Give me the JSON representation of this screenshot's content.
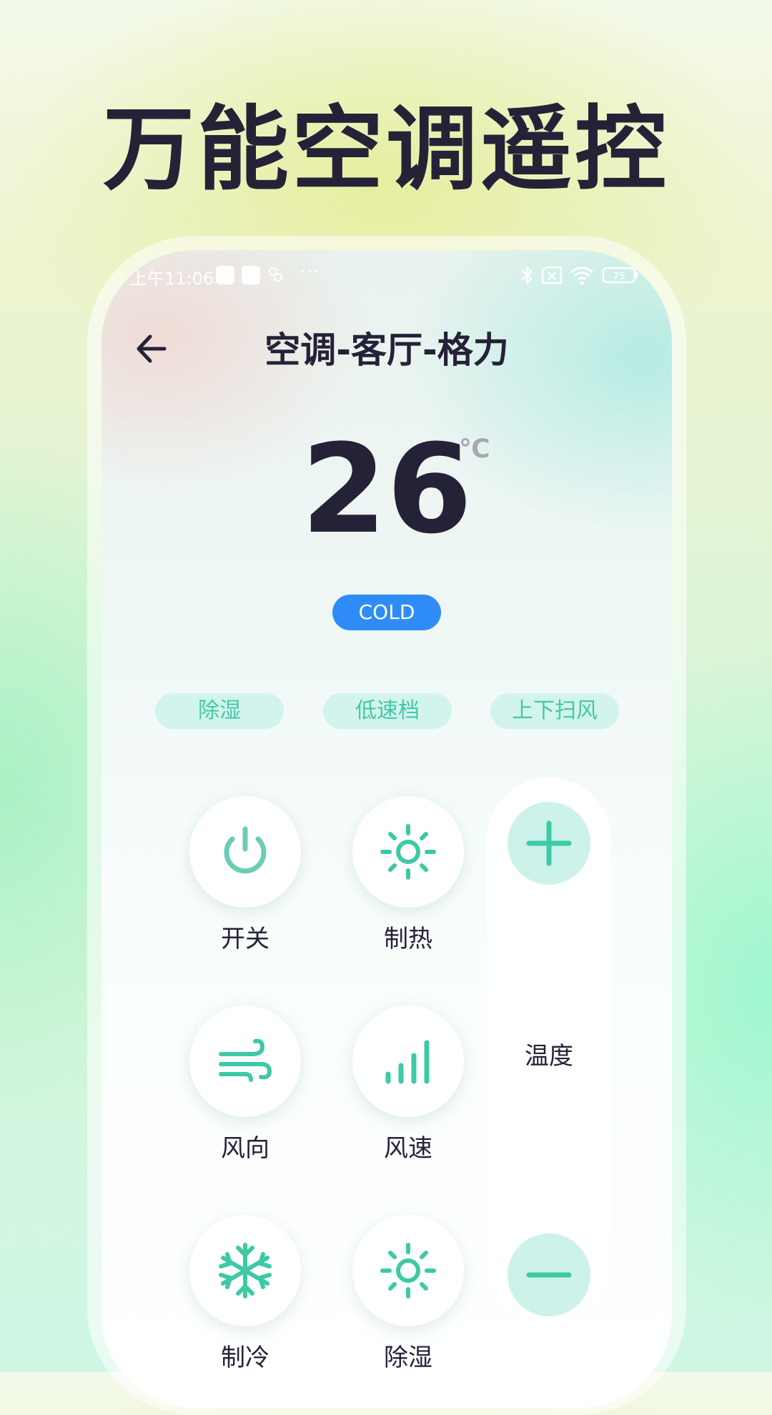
{
  "promo": {
    "headline": "万能空调遥控"
  },
  "status_bar": {
    "time": "上午11:06",
    "more": "···",
    "battery": "75"
  },
  "header": {
    "title": "空调-客厅-格力"
  },
  "display": {
    "temperature": "26",
    "unit": "℃",
    "mode": "COLD"
  },
  "chips": [
    "除湿",
    "低速档",
    "上下扫风"
  ],
  "controls": [
    {
      "label": "开关",
      "icon": "power-icon"
    },
    {
      "label": "制热",
      "icon": "sun-icon"
    },
    {
      "label": "风向",
      "icon": "wind-icon"
    },
    {
      "label": "风速",
      "icon": "signal-bars-icon"
    },
    {
      "label": "制冷",
      "icon": "snowflake-icon"
    },
    {
      "label": "除湿",
      "icon": "sun-icon"
    }
  ],
  "temperature_control": {
    "label": "温度",
    "increase_icon": "plus-icon",
    "decrease_icon": "minus-icon"
  },
  "colors": {
    "accent": "#3dc9a6",
    "badge": "#2f8cf6",
    "text": "#252238",
    "chip_bg": "#d2f4ec"
  }
}
